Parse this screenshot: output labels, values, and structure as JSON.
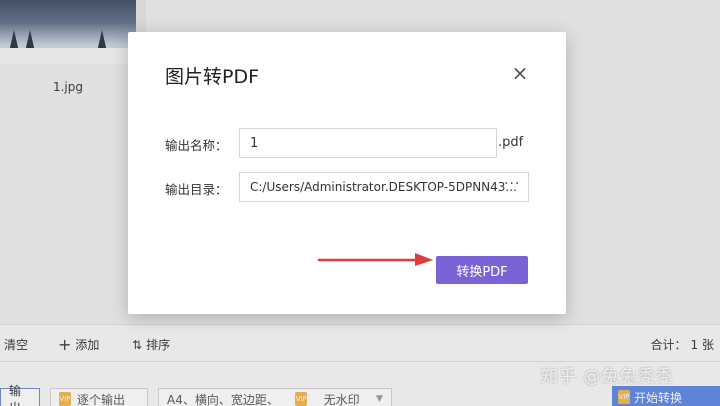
{
  "background": {
    "file_name": "1.jpg",
    "toolbar": {
      "clear_label": "清空",
      "add_label": "添加",
      "sort_label": "排序",
      "count_label": "合计：",
      "count_value": "1 张"
    },
    "options": {
      "output_label": "输出",
      "each_output_label": "逐个输出",
      "paper_label": "A4、横向、宽边距、",
      "watermark_label": "无水印"
    },
    "start_button_label": "开始转换",
    "watermark_text": "知乎 @兔兔秃秃"
  },
  "dialog": {
    "title": "图片转PDF",
    "close_icon": "×",
    "name_label": "输出名称：",
    "name_value": "1",
    "name_extension": ".pdf",
    "dir_label": "输出目录：",
    "dir_value": "C:/Users/Administrator.DESKTOP-5DPNN43...",
    "more_icon": "···",
    "convert_label": "转换PDF"
  },
  "colors": {
    "accent": "#7a63d6",
    "arrow": "#e23a3a",
    "start_button": "#5b86e5"
  }
}
